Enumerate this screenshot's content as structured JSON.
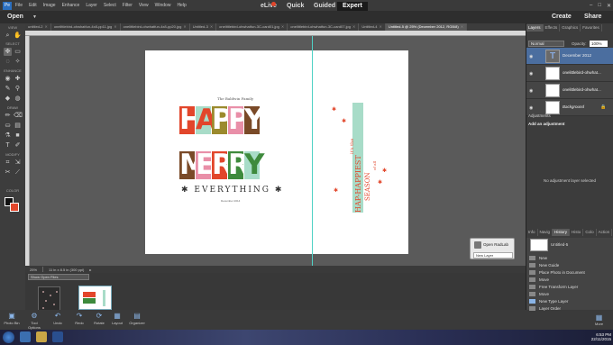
{
  "menubar": {
    "items": [
      "File",
      "Edit",
      "Image",
      "Enhance",
      "Layer",
      "Select",
      "Filter",
      "View",
      "Window",
      "Help"
    ]
  },
  "modebar": {
    "open": "Open",
    "elive": "eLive",
    "quick": "Quick",
    "guided": "Guided",
    "expert": "Expert",
    "create": "Create",
    "share": "Share"
  },
  "tabs": [
    "untitled-2",
    "onelittlebird-ohwhatfun-4x8-pp11.jpg",
    "onelittlebird-ohwhatfun-4x8-pp20.jpg",
    "Untitled-3",
    "onelittlebird-ohwhatfun-3C-card01.jpg",
    "onelittlebird-ohwhatfun-3C-card07.jpg",
    "Untitled-4",
    "Untitled-5 @ 25% (December 2012, RGB/8)"
  ],
  "toolbar": {
    "view": "VIEW",
    "select": "SELECT",
    "enhance": "ENHANCE",
    "draw": "DRAW",
    "modify": "MODIFY",
    "color": "COLOR"
  },
  "document": {
    "family": "The Baldwin Family",
    "happy": [
      "H",
      "A",
      "P",
      "P",
      "Y"
    ],
    "merry": [
      "M",
      "E",
      "R",
      "R",
      "Y"
    ],
    "everything": "✱ EVERYTHING ✱",
    "date": "December 2014",
    "vertical": {
      "its": "it's the",
      "hap": "HAP-HAPPIEST",
      "season": "SEASON",
      "of": "of all"
    }
  },
  "status": {
    "zoom": "25%",
    "size": "11 in x 8.5 in (300 ppi)"
  },
  "bin": {
    "show": "Show Open Files"
  },
  "radlab": {
    "title": "Open RadLab",
    "select": "New Layer"
  },
  "bottom": [
    "Photo Bin",
    "Tool Options",
    "Undo",
    "Redo",
    "Rotate",
    "Layout",
    "Organizer"
  ],
  "more": "More",
  "panel": {
    "tabs": [
      "Layers",
      "Effects",
      "Graphics",
      "Favorites"
    ],
    "blend": "Normal",
    "opacity_label": "Opacity:",
    "opacity": "100%",
    "layers": [
      "December 2012",
      "onelittlebird-ohwhat...",
      "onelittlebird-ohwhat...",
      "Background"
    ],
    "adj_title": "Adjustments",
    "adj_head": "Add an adjustment",
    "noadj": "No adjustment layer selected",
    "histtabs": [
      "Info",
      "Navig",
      "History",
      "Histo",
      "Colo",
      "Action"
    ],
    "history": [
      "Untitled-5",
      "New",
      "New Guide",
      "Place Photo in Document",
      "Move",
      "Free Transform Layer",
      "Move",
      "New Type Layer",
      "Layer Order"
    ]
  },
  "clock": {
    "time": "6:53 PM",
    "date": "22/11/2015"
  },
  "colors": {
    "red": "#e2462b",
    "mint": "#a8dcc8",
    "olive": "#9b8a2d",
    "brown": "#7a4a28",
    "pink": "#e98fa8",
    "green": "#3e8a3c",
    "blue": "#4b6e9f"
  }
}
